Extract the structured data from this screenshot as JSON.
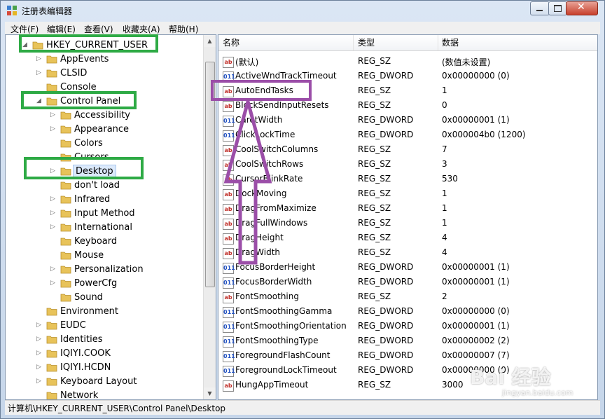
{
  "window": {
    "title": "注册表编辑器",
    "buttons": {
      "minimize": "minimize",
      "maximize": "maximize",
      "close": "close"
    }
  },
  "menu": [
    "文件(F)",
    "编辑(E)",
    "查看(V)",
    "收藏夹(A)",
    "帮助(H)"
  ],
  "tree": {
    "nodes": [
      {
        "label": "HKEY_CURRENT_USER",
        "expander": "◢",
        "level": 0
      },
      {
        "label": "AppEvents",
        "expander": "▷",
        "level": 1
      },
      {
        "label": "CLSID",
        "expander": "▷",
        "level": 1
      },
      {
        "label": "Console",
        "expander": "",
        "level": 1
      },
      {
        "label": "Control Panel",
        "expander": "◢",
        "level": 1
      },
      {
        "label": "Accessibility",
        "expander": "▷",
        "level": 2
      },
      {
        "label": "Appearance",
        "expander": "▷",
        "level": 2
      },
      {
        "label": "Colors",
        "expander": "",
        "level": 2
      },
      {
        "label": "Cursors",
        "expander": "",
        "level": 2
      },
      {
        "label": "Desktop",
        "expander": "▷",
        "level": 2,
        "selected": true
      },
      {
        "label": "don't load",
        "expander": "",
        "level": 2
      },
      {
        "label": "Infrared",
        "expander": "▷",
        "level": 2
      },
      {
        "label": "Input Method",
        "expander": "▷",
        "level": 2
      },
      {
        "label": "International",
        "expander": "▷",
        "level": 2
      },
      {
        "label": "Keyboard",
        "expander": "",
        "level": 2
      },
      {
        "label": "Mouse",
        "expander": "",
        "level": 2
      },
      {
        "label": "Personalization",
        "expander": "▷",
        "level": 2
      },
      {
        "label": "PowerCfg",
        "expander": "▷",
        "level": 2
      },
      {
        "label": "Sound",
        "expander": "",
        "level": 2
      },
      {
        "label": "Environment",
        "expander": "",
        "level": 1
      },
      {
        "label": "EUDC",
        "expander": "▷",
        "level": 1
      },
      {
        "label": "Identities",
        "expander": "▷",
        "level": 1
      },
      {
        "label": "IQIYI.COOK",
        "expander": "▷",
        "level": 1
      },
      {
        "label": "IQIYI.HCDN",
        "expander": "▷",
        "level": 1
      },
      {
        "label": "Keyboard Layout",
        "expander": "▷",
        "level": 1
      },
      {
        "label": "Network",
        "expander": "",
        "level": 1
      }
    ]
  },
  "list": {
    "headers": [
      "名称",
      "类型",
      "数据"
    ],
    "rows": [
      {
        "name": "(默认)",
        "type": "REG_SZ",
        "data": "(数值未设置)"
      },
      {
        "name": "ActiveWndTrackTimeout",
        "type": "REG_DWORD",
        "data": "0x00000000 (0)"
      },
      {
        "name": "AutoEndTasks",
        "type": "REG_SZ",
        "data": "1"
      },
      {
        "name": "BlockSendInputResets",
        "type": "REG_SZ",
        "data": "0"
      },
      {
        "name": "CaretWidth",
        "type": "REG_DWORD",
        "data": "0x00000001 (1)"
      },
      {
        "name": "ClickLockTime",
        "type": "REG_DWORD",
        "data": "0x000004b0 (1200)"
      },
      {
        "name": "CoolSwitchColumns",
        "type": "REG_SZ",
        "data": "7"
      },
      {
        "name": "CoolSwitchRows",
        "type": "REG_SZ",
        "data": "3"
      },
      {
        "name": "CursorBlinkRate",
        "type": "REG_SZ",
        "data": "530"
      },
      {
        "name": "DockMoving",
        "type": "REG_SZ",
        "data": "1"
      },
      {
        "name": "DragFromMaximize",
        "type": "REG_SZ",
        "data": "1"
      },
      {
        "name": "DragFullWindows",
        "type": "REG_SZ",
        "data": "1"
      },
      {
        "name": "DragHeight",
        "type": "REG_SZ",
        "data": "4"
      },
      {
        "name": "DragWidth",
        "type": "REG_SZ",
        "data": "4"
      },
      {
        "name": "FocusBorderHeight",
        "type": "REG_DWORD",
        "data": "0x00000001 (1)"
      },
      {
        "name": "FocusBorderWidth",
        "type": "REG_DWORD",
        "data": "0x00000001 (1)"
      },
      {
        "name": "FontSmoothing",
        "type": "REG_SZ",
        "data": "2"
      },
      {
        "name": "FontSmoothingGamma",
        "type": "REG_DWORD",
        "data": "0x00000000 (0)"
      },
      {
        "name": "FontSmoothingOrientation",
        "type": "REG_DWORD",
        "data": "0x00000001 (1)"
      },
      {
        "name": "FontSmoothingType",
        "type": "REG_DWORD",
        "data": "0x00000002 (2)"
      },
      {
        "name": "ForegroundFlashCount",
        "type": "REG_DWORD",
        "data": "0x00000007 (7)"
      },
      {
        "name": "ForegroundLockTimeout",
        "type": "REG_DWORD",
        "data": "0x00000000 (0)"
      },
      {
        "name": "HungAppTimeout",
        "type": "REG_SZ",
        "data": "3000"
      }
    ]
  },
  "status": "计算机\\HKEY_CURRENT_USER\\Control Panel\\Desktop",
  "watermark": {
    "logo": "Bai 经验",
    "url": "jingyan.baidu.com"
  },
  "colors": {
    "green_highlight": "#2eaa45",
    "purple_highlight": "#9b4ea8"
  }
}
